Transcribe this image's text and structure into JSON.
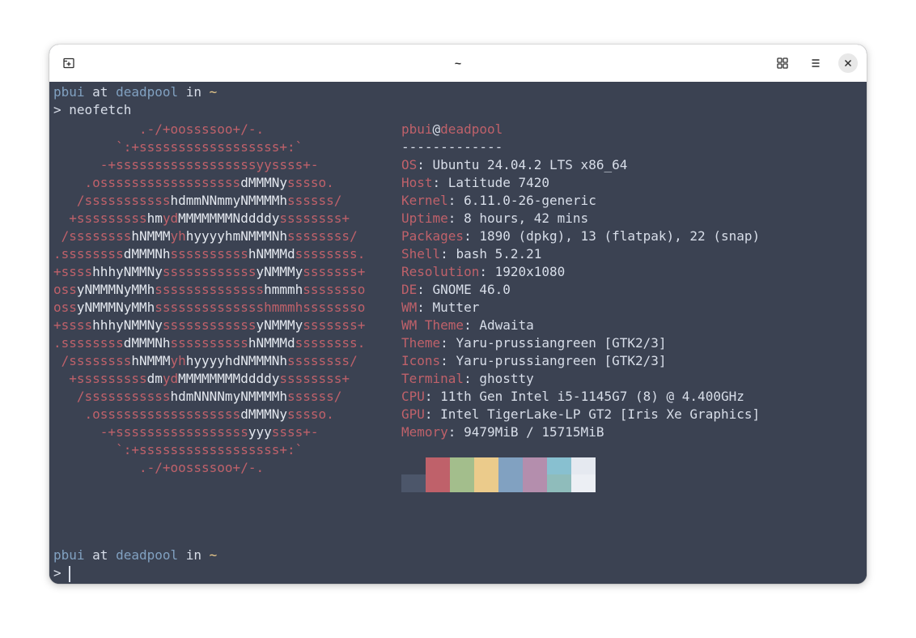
{
  "window": {
    "title": "~"
  },
  "colors": {
    "terminal_bg": "#3b4252",
    "foreground": "#d8dee9",
    "red": "#bf616a",
    "white": "#e5e9f0",
    "blue": "#81a1c1",
    "yellow": "#ebcb8b"
  },
  "icons": {
    "new_tab": "new-tab-icon",
    "tab_overview": "grid-icon",
    "menu": "hamburger-menu-icon",
    "close": "close-icon"
  },
  "prompt1": {
    "user": "pbui",
    "at": " at ",
    "host": "deadpool",
    "in": " in ",
    "dir": "~"
  },
  "command": {
    "symbol": ">",
    "text": "neofetch"
  },
  "ascii_art": [
    "           .-/+oossssoo+/-.",
    "        `:+ssssssssssssssssss+:`",
    "      -+ssssssssssssssssssyyssss+-",
    "    .ossssssssssssssssssdMMMNysssso.",
    "   /ssssssssssshdmmNNmmyNMMMMhssssss/",
    "  +ssssssssshmydMMMMMMMNddddyssssssss+",
    " /sssssssshNMMMyhhyyyyhmNMMMNhssssssss/",
    ".ssssssssdMMMNhsssssssssshNMMMdssssssss.",
    "+sssshhhyNMMNyssssssssssssyNMMMysssssss+",
    "ossyNMMMNyMMhsssssssssssssshmmmhssssssso",
    "ossyNMMMNyMMhsssssssssssssshmmmhssssssso",
    "+sssshhhyNMMNyssssssssssssyNMMMysssssss+",
    ".ssssssssdMMMNhsssssssssshNMMMdssssssss.",
    " /sssssssshNMMMyhhyyyyhdNMMMNhssssssss/",
    "  +sssssssssdmydMMMMMMMMddddyssssssss+",
    "   /ssssssssssshdmNNNNmyNMMMMhssssss/",
    "    .ossssssssssssssssssdMMMNysssso.",
    "      -+sssssssssssssssssyyyssss+-",
    "        `:+ssssssssssssssssss+:`",
    "           .-/+oossssoo+/-."
  ],
  "ascii_segments": [
    [
      {
        "t": "           .-/+oossssoo+/-.",
        "c": "r"
      }
    ],
    [
      {
        "t": "        `:+ssssssssssssssssss+:`",
        "c": "r"
      }
    ],
    [
      {
        "t": "      -+ssssssssssssssssssyyssss+-",
        "c": "r"
      }
    ],
    [
      {
        "t": "    .ossssssssssssssssss",
        "c": "r"
      },
      {
        "t": "dMMMNy",
        "c": "w"
      },
      {
        "t": "sssso.",
        "c": "r"
      }
    ],
    [
      {
        "t": "   /sssssssssss",
        "c": "r"
      },
      {
        "t": "hdmmNNmmyNMMMMh",
        "c": "w"
      },
      {
        "t": "ssssss/",
        "c": "r"
      }
    ],
    [
      {
        "t": "  +sssssssss",
        "c": "r"
      },
      {
        "t": "hm",
        "c": "w"
      },
      {
        "t": "yd",
        "c": "r"
      },
      {
        "t": "MMMMMMMNddddy",
        "c": "w"
      },
      {
        "t": "ssssssss+",
        "c": "r"
      }
    ],
    [
      {
        "t": " /ssssssss",
        "c": "r"
      },
      {
        "t": "hNMMM",
        "c": "w"
      },
      {
        "t": "yh",
        "c": "r"
      },
      {
        "t": "hyyyyhmNMMMNh",
        "c": "w"
      },
      {
        "t": "ssssssss/",
        "c": "r"
      }
    ],
    [
      {
        "t": ".ssssssss",
        "c": "r"
      },
      {
        "t": "dMMMNh",
        "c": "w"
      },
      {
        "t": "ssssssssss",
        "c": "r"
      },
      {
        "t": "hNMMMd",
        "c": "w"
      },
      {
        "t": "ssssssss.",
        "c": "r"
      }
    ],
    [
      {
        "t": "+ssss",
        "c": "r"
      },
      {
        "t": "hhhyNMMNy",
        "c": "w"
      },
      {
        "t": "ssssssssssss",
        "c": "r"
      },
      {
        "t": "yNMMMy",
        "c": "w"
      },
      {
        "t": "sssssss+",
        "c": "r"
      }
    ],
    [
      {
        "t": "oss",
        "c": "r"
      },
      {
        "t": "yNMMMNyMMh",
        "c": "w"
      },
      {
        "t": "ssssssssssssss",
        "c": "r"
      },
      {
        "t": "hmmmh",
        "c": "w"
      },
      {
        "t": "ssssssso",
        "c": "r"
      }
    ],
    [
      {
        "t": "oss",
        "c": "r"
      },
      {
        "t": "yNMMMNyMMh",
        "c": "w"
      },
      {
        "t": "sssssssssssssshmmmhssssssso",
        "c": "r"
      }
    ],
    [
      {
        "t": "+ssss",
        "c": "r"
      },
      {
        "t": "hhhyNMMNy",
        "c": "w"
      },
      {
        "t": "ssssssssssss",
        "c": "r"
      },
      {
        "t": "yNMMMy",
        "c": "w"
      },
      {
        "t": "sssssss+",
        "c": "r"
      }
    ],
    [
      {
        "t": ".ssssssss",
        "c": "r"
      },
      {
        "t": "dMMMNh",
        "c": "w"
      },
      {
        "t": "ssssssssss",
        "c": "r"
      },
      {
        "t": "hNMMMd",
        "c": "w"
      },
      {
        "t": "ssssssss.",
        "c": "r"
      }
    ],
    [
      {
        "t": " /ssssssss",
        "c": "r"
      },
      {
        "t": "hNMMM",
        "c": "w"
      },
      {
        "t": "yh",
        "c": "r"
      },
      {
        "t": "hyyyyhdNMMMNh",
        "c": "w"
      },
      {
        "t": "ssssssss/",
        "c": "r"
      }
    ],
    [
      {
        "t": "  +sssssssss",
        "c": "r"
      },
      {
        "t": "dm",
        "c": "w"
      },
      {
        "t": "yd",
        "c": "r"
      },
      {
        "t": "MMMMMMMMddddy",
        "c": "w"
      },
      {
        "t": "ssssssss+",
        "c": "r"
      }
    ],
    [
      {
        "t": "   /sssssssssss",
        "c": "r"
      },
      {
        "t": "hdmNNNNmyNMMMMh",
        "c": "w"
      },
      {
        "t": "ssssss/",
        "c": "r"
      }
    ],
    [
      {
        "t": "    .ossssssssssssssssss",
        "c": "r"
      },
      {
        "t": "dMMMNy",
        "c": "w"
      },
      {
        "t": "sssso.",
        "c": "r"
      }
    ],
    [
      {
        "t": "      -+sssssssssssssssss",
        "c": "r"
      },
      {
        "t": "yyy",
        "c": "w"
      },
      {
        "t": "ssss+-",
        "c": "r"
      }
    ],
    [
      {
        "t": "        `:+ssssssssssssssssss+:`",
        "c": "r"
      }
    ],
    [
      {
        "t": "           .-/+oossssoo+/-.",
        "c": "r"
      }
    ]
  ],
  "info": {
    "user": "pbui",
    "at": "@",
    "host": "deadpool",
    "separator": "-------------",
    "fields": [
      {
        "label": "OS",
        "value": "Ubuntu 24.04.2 LTS x86_64"
      },
      {
        "label": "Host",
        "value": "Latitude 7420"
      },
      {
        "label": "Kernel",
        "value": "6.11.0-26-generic"
      },
      {
        "label": "Uptime",
        "value": "8 hours, 42 mins"
      },
      {
        "label": "Packages",
        "value": "1890 (dpkg), 13 (flatpak), 22 (snap)"
      },
      {
        "label": "Shell",
        "value": "bash 5.2.21"
      },
      {
        "label": "Resolution",
        "value": "1920x1080"
      },
      {
        "label": "DE",
        "value": "GNOME 46.0"
      },
      {
        "label": "WM",
        "value": "Mutter"
      },
      {
        "label": "WM Theme",
        "value": "Adwaita"
      },
      {
        "label": "Theme",
        "value": "Yaru-prussiangreen [GTK2/3]"
      },
      {
        "label": "Icons",
        "value": "Yaru-prussiangreen [GTK2/3]"
      },
      {
        "label": "Terminal",
        "value": "ghostty"
      },
      {
        "label": "CPU",
        "value": "11th Gen Intel i5-1145G7 (8) @ 4.400GHz"
      },
      {
        "label": "GPU",
        "value": "Intel TigerLake-LP GT2 [Iris Xe Graphics]"
      },
      {
        "label": "Memory",
        "value": "9479MiB / 15715MiB"
      }
    ],
    "palette_top": [
      "#3b4252",
      "#bf616a",
      "#a3be8c",
      "#ebcb8b",
      "#81a1c1",
      "#b48ead",
      "#88c0d0",
      "#e5e9f0"
    ],
    "palette_bottom": [
      "#4c566a",
      "#bf616a",
      "#a3be8c",
      "#ebcb8b",
      "#81a1c1",
      "#b48ead",
      "#8fbcbb",
      "#eceff4"
    ]
  },
  "prompt2": {
    "user": "pbui",
    "at": " at ",
    "host": "deadpool",
    "in": " in ",
    "dir": "~"
  },
  "prompt2_symbol": ">"
}
